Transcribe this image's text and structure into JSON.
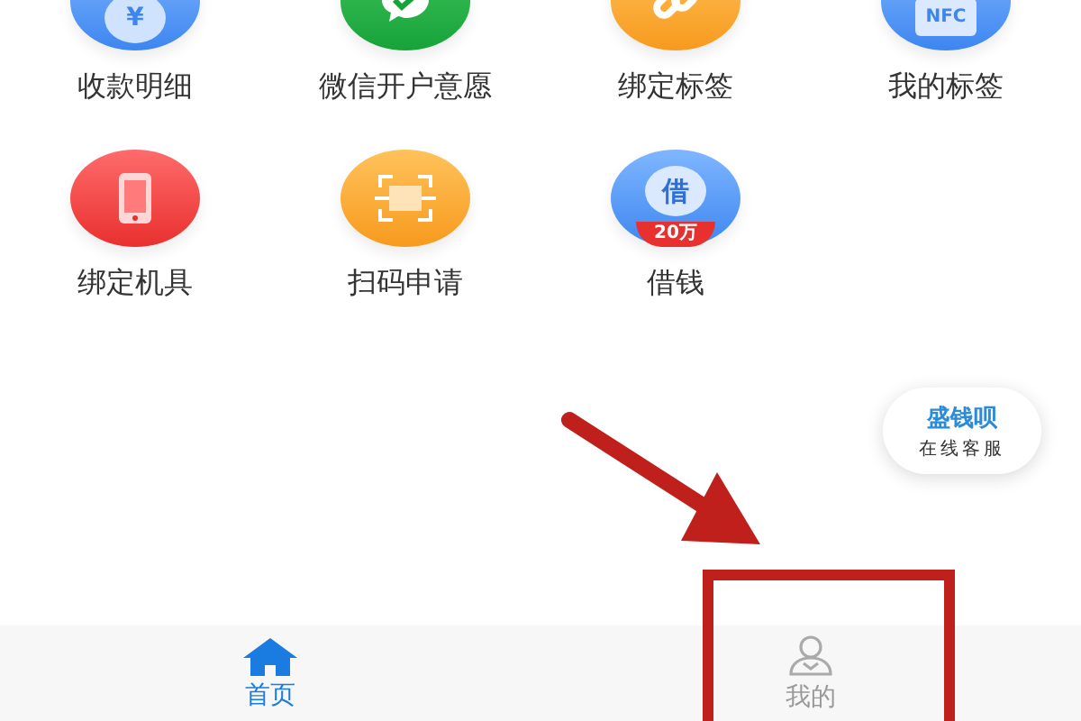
{
  "apps": [
    {
      "label": "收款明细",
      "kind": "yuan",
      "icon_text": "¥"
    },
    {
      "label": "微信开户意愿",
      "kind": "chat"
    },
    {
      "label": "绑定标签",
      "kind": "link"
    },
    {
      "label": "我的标签",
      "kind": "nfc",
      "icon_text": "NFC"
    },
    {
      "label": "绑定机具",
      "kind": "phone"
    },
    {
      "label": "扫码申请",
      "kind": "scan"
    },
    {
      "label": "借钱",
      "kind": "loan",
      "icon_text": "借",
      "badge": "20万"
    }
  ],
  "support_button": {
    "title": "盛钱呗",
    "subtitle": "在线客服"
  },
  "tabs": [
    {
      "label": "首页",
      "kind": "home",
      "selected": true
    },
    {
      "label": "我的",
      "kind": "person",
      "selected": false
    }
  ],
  "annotation": {
    "kind": "arrow-box"
  }
}
